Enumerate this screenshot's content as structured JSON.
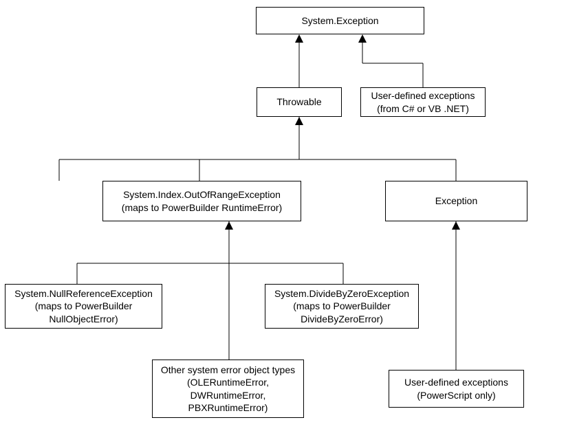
{
  "nodes": {
    "root": {
      "label": "System.Exception"
    },
    "throwable": {
      "label": "Throwable"
    },
    "userDefinedNet": {
      "line1": "User-defined exceptions",
      "line2": "(from C# or VB .NET)"
    },
    "outOfRange": {
      "line1": "System.Index.OutOfRangeException",
      "line2": "(maps to PowerBuilder RuntimeError)"
    },
    "exception": {
      "label": "Exception"
    },
    "nullRef": {
      "line1": "System.NullReferenceException",
      "line2": "(maps to PowerBuilder",
      "line3": "NullObjectError)"
    },
    "divideByZero": {
      "line1": "System.DivideByZeroException",
      "line2": "(maps to PowerBuilder",
      "line3": "DivideByZeroError)"
    },
    "otherErrors": {
      "line1": "Other system error object types",
      "line2": "(OLERuntimeError,",
      "line3": "DWRuntimeError,",
      "line4": "PBXRuntimeError)"
    },
    "userDefinedPS": {
      "line1": "User-defined exceptions",
      "line2": "(PowerScript only)"
    }
  }
}
